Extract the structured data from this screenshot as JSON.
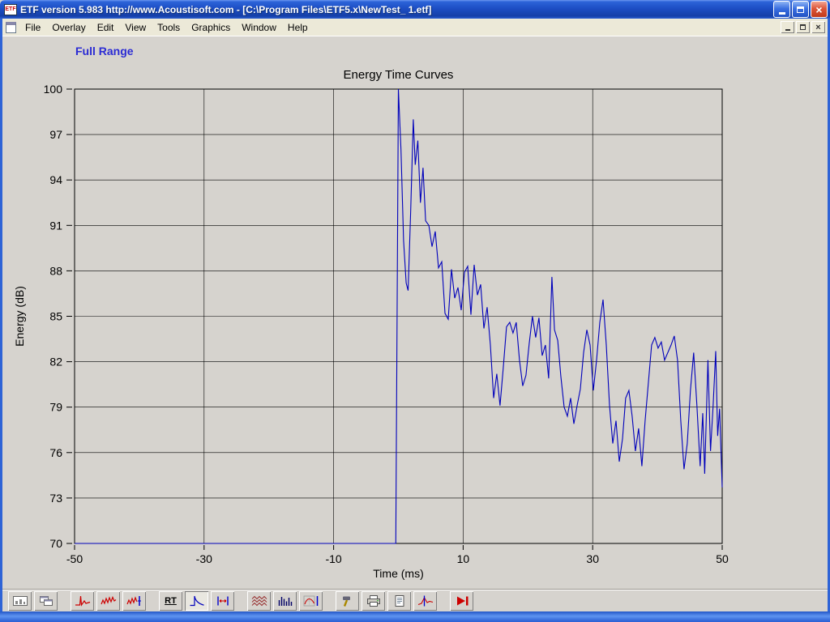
{
  "window": {
    "icon_text": "ETF",
    "title": "ETF version 5.983 http://www.Acoustisoft.com - [C:\\Program Files\\ETF5.x\\NewTest_ 1.etf]"
  },
  "menu_bar": {
    "items": [
      "File",
      "Overlay",
      "Edit",
      "View",
      "Tools",
      "Graphics",
      "Window",
      "Help"
    ]
  },
  "view_label": "Full Range",
  "chart_data": {
    "type": "line",
    "title": "Energy Time Curves",
    "xlabel": "Time (ms)",
    "ylabel": "Energy (dB)",
    "xlim": [
      -50,
      50
    ],
    "ylim": [
      70,
      100
    ],
    "x_ticks": [
      -50,
      -30,
      -10,
      10,
      30,
      50
    ],
    "y_ticks": [
      70,
      73,
      76,
      79,
      82,
      85,
      88,
      91,
      94,
      97,
      100
    ],
    "grid": true,
    "legend": false,
    "line_color": "#0000BB",
    "series": [
      {
        "name": "Energy Time Curve",
        "points": [
          [
            -50,
            70
          ],
          [
            -0.4,
            70
          ],
          [
            0,
            100
          ],
          [
            0.4,
            96
          ],
          [
            0.8,
            90
          ],
          [
            1.2,
            87.2
          ],
          [
            1.5,
            86.7
          ],
          [
            1.9,
            92
          ],
          [
            2.3,
            98
          ],
          [
            2.6,
            95
          ],
          [
            3.0,
            96.6
          ],
          [
            3.4,
            92.5
          ],
          [
            3.8,
            94.8
          ],
          [
            4.2,
            91.3
          ],
          [
            4.7,
            91
          ],
          [
            5.2,
            89.6
          ],
          [
            5.7,
            90.6
          ],
          [
            6.2,
            88.2
          ],
          [
            6.7,
            88.6
          ],
          [
            7.2,
            85.2
          ],
          [
            7.7,
            84.8
          ],
          [
            8.2,
            88.1
          ],
          [
            8.7,
            86.2
          ],
          [
            9.2,
            86.9
          ],
          [
            9.7,
            85.4
          ],
          [
            10.2,
            87.9
          ],
          [
            10.7,
            88.3
          ],
          [
            11.2,
            85.1
          ],
          [
            11.7,
            88.4
          ],
          [
            12.2,
            86.4
          ],
          [
            12.7,
            87.1
          ],
          [
            13.2,
            84.2
          ],
          [
            13.7,
            85.6
          ],
          [
            14.2,
            83.1
          ],
          [
            14.7,
            79.6
          ],
          [
            15.2,
            81.2
          ],
          [
            15.7,
            79.1
          ],
          [
            16.2,
            81.6
          ],
          [
            16.7,
            84.3
          ],
          [
            17.2,
            84.6
          ],
          [
            17.7,
            83.9
          ],
          [
            18.2,
            84.6
          ],
          [
            18.7,
            82.1
          ],
          [
            19.2,
            80.4
          ],
          [
            19.7,
            81.1
          ],
          [
            20.2,
            83.2
          ],
          [
            20.7,
            85
          ],
          [
            21.2,
            83.6
          ],
          [
            21.7,
            84.9
          ],
          [
            22.2,
            82.4
          ],
          [
            22.7,
            83.1
          ],
          [
            23.2,
            80.9
          ],
          [
            23.7,
            87.6
          ],
          [
            24.1,
            84.1
          ],
          [
            24.6,
            83.4
          ],
          [
            25.1,
            81
          ],
          [
            25.6,
            79
          ],
          [
            26.1,
            78.4
          ],
          [
            26.6,
            79.6
          ],
          [
            27.1,
            77.9
          ],
          [
            27.6,
            79.1
          ],
          [
            28.1,
            80.2
          ],
          [
            28.6,
            82.6
          ],
          [
            29.1,
            84.1
          ],
          [
            29.6,
            83.1
          ],
          [
            30.1,
            80.1
          ],
          [
            30.6,
            82.1
          ],
          [
            31.1,
            84.6
          ],
          [
            31.6,
            86.1
          ],
          [
            32.1,
            83.1
          ],
          [
            32.6,
            79.1
          ],
          [
            33.1,
            76.6
          ],
          [
            33.6,
            78.1
          ],
          [
            34.1,
            75.4
          ],
          [
            34.6,
            76.9
          ],
          [
            35.1,
            79.6
          ],
          [
            35.6,
            80.1
          ],
          [
            36.1,
            78.4
          ],
          [
            36.6,
            76.1
          ],
          [
            37.1,
            77.6
          ],
          [
            37.6,
            75.1
          ],
          [
            38.1,
            78.1
          ],
          [
            38.6,
            80.6
          ],
          [
            39.1,
            83.1
          ],
          [
            39.6,
            83.6
          ],
          [
            40.1,
            82.9
          ],
          [
            40.6,
            83.3
          ],
          [
            41.1,
            82.1
          ],
          [
            41.6,
            82.6
          ],
          [
            42.1,
            83.1
          ],
          [
            42.6,
            83.7
          ],
          [
            43.1,
            82.1
          ],
          [
            43.6,
            78.1
          ],
          [
            44.1,
            74.9
          ],
          [
            44.6,
            76.6
          ],
          [
            45.1,
            80.1
          ],
          [
            45.6,
            82.6
          ],
          [
            46.1,
            79.1
          ],
          [
            46.6,
            75.1
          ],
          [
            47,
            78.6
          ],
          [
            47.3,
            74.6
          ],
          [
            47.8,
            82.1
          ],
          [
            48.2,
            76.1
          ],
          [
            48.6,
            79.1
          ],
          [
            49,
            82.7
          ],
          [
            49.3,
            77.1
          ],
          [
            49.6,
            78.9
          ],
          [
            50,
            73.7
          ]
        ]
      }
    ]
  },
  "toolbar": {
    "buttons": [
      {
        "id": "time-record",
        "icon": "meter",
        "group": 1
      },
      {
        "id": "cascade-windows",
        "icon": "cascade",
        "group": 1
      },
      {
        "id": "impulse-response",
        "icon": "impulse",
        "group": 2
      },
      {
        "id": "frequency-response",
        "icon": "freq",
        "group": 2
      },
      {
        "id": "phase-response",
        "icon": "freqphase",
        "group": 2
      },
      {
        "id": "reverb-time",
        "label": "RT",
        "group": 3
      },
      {
        "id": "energy-time-curve",
        "icon": "etc",
        "group": 3,
        "active": true
      },
      {
        "id": "gated-window",
        "icon": "gate",
        "group": 3
      },
      {
        "id": "waterfall",
        "icon": "waterfall",
        "group": 4
      },
      {
        "id": "spectrogram",
        "icon": "spectro",
        "group": 4
      },
      {
        "id": "grid-plot",
        "icon": "gridcurve",
        "group": 4
      },
      {
        "id": "tools",
        "icon": "hammer",
        "group": 5
      },
      {
        "id": "print",
        "icon": "printer",
        "group": 5
      },
      {
        "id": "notes",
        "icon": "document",
        "group": 5
      },
      {
        "id": "cursor-plot",
        "icon": "cursorplot",
        "group": 5
      },
      {
        "id": "run-measurement",
        "icon": "play",
        "group": 6
      }
    ]
  },
  "colors": {
    "accent_blue": "#2B2BD4",
    "curve": "#0000BB",
    "titlebar_blue": "#1D4EC4",
    "menu_bg": "#ECE9D8",
    "client_bg": "#D6D3CE"
  }
}
